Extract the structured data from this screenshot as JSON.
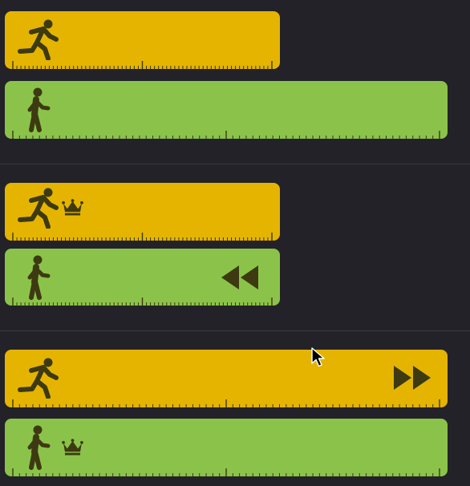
{
  "colors": {
    "background": "#232228",
    "run_bar": "#e4b400",
    "walk_bar": "#8bc34a",
    "icon": "#3d3a12",
    "divider": "#3a3940"
  },
  "groups": [
    {
      "bars": [
        {
          "type": "run",
          "icons": [
            "runner-icon"
          ]
        },
        {
          "type": "walk",
          "icons": [
            "walker-icon"
          ]
        }
      ]
    },
    {
      "bars": [
        {
          "type": "run",
          "icons": [
            "runner-icon",
            "crown-icon"
          ]
        },
        {
          "type": "walk",
          "icons": [
            "walker-icon",
            "rewind-icon"
          ]
        }
      ]
    },
    {
      "bars": [
        {
          "type": "run",
          "icons": [
            "runner-icon",
            "fast-forward-icon"
          ]
        },
        {
          "type": "walk",
          "icons": [
            "walker-icon",
            "crown-icon"
          ]
        }
      ]
    }
  ]
}
